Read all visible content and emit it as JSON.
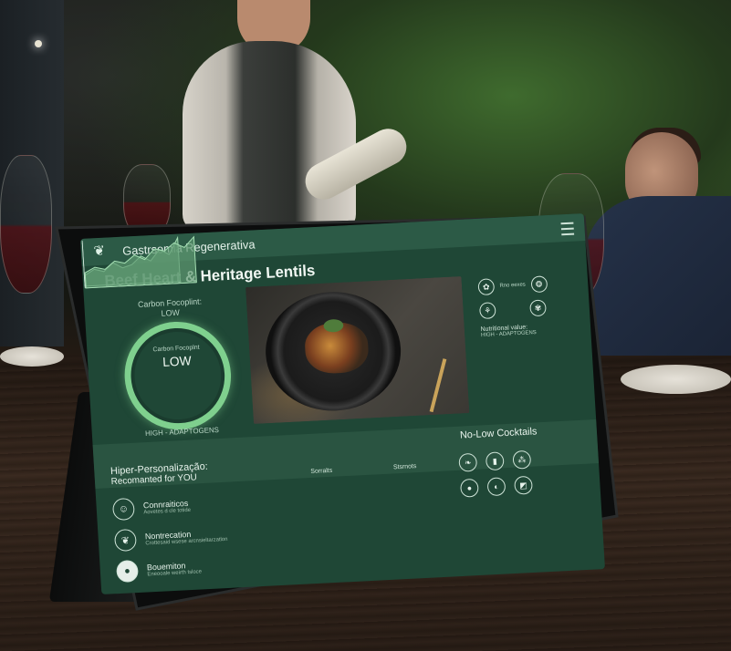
{
  "app": {
    "title": "Gastrsomia Regenerativa"
  },
  "dish": {
    "name": "Beef Heart & Heritage Lentils"
  },
  "carbon": {
    "top_label": "Carbon Focoplint:",
    "top_value": "LOW",
    "ring_label": "Carbon Focoplnt",
    "ring_value": "LOW",
    "adaptogens": "HIGH - ADAPTOGENS"
  },
  "nutrition": {
    "icon_label": "Rno eexes",
    "title": "Nutritional value:",
    "subtitle": "HIGH - ADAPTOGENS"
  },
  "cocktails": {
    "title": "No-Low Cocktails"
  },
  "personalization": {
    "title": "Hiper-Personalização:",
    "subtitle": "Recomanted for YOU"
  },
  "chart": {
    "label_left": "Sorralts",
    "label_right": "Stsrnots"
  },
  "recommendations": [
    {
      "title": "Connraiticos",
      "sub": "Aovetes d cle totide",
      "icon": "person-icon"
    },
    {
      "title": "Nontrecation",
      "sub": "Crottesaid wsese arcnsieltarzatlon",
      "icon": "herb-icon"
    },
    {
      "title": "Bouemiton",
      "sub": "Eneooale weirth tsloce",
      "icon": "mushroom-icon"
    }
  ],
  "colors": {
    "screen_bg": "#1f4736",
    "accent": "#7fd08e",
    "header": "#2c5a46"
  },
  "chart_data": [
    {
      "type": "area",
      "values": [
        2,
        3,
        2.5,
        4,
        3,
        3.5,
        5,
        4,
        6,
        5,
        8
      ]
    },
    {
      "type": "area",
      "values": [
        3,
        4,
        3.5,
        5,
        4.5,
        6,
        5,
        7,
        6.5,
        8,
        7,
        9
      ]
    }
  ]
}
